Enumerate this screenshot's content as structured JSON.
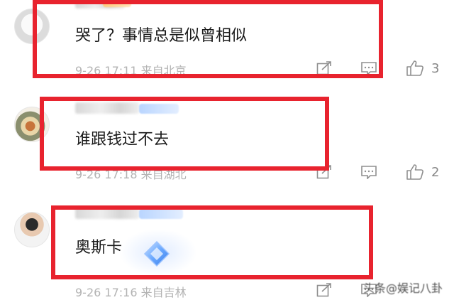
{
  "comments": [
    {
      "text": "哭了？事情总是似曾相似",
      "meta": "9-26 17:11 来自北京",
      "likes": "3",
      "avatar_icon": "dog-avatar"
    },
    {
      "text": "谁跟钱过不去",
      "meta": "9-26 17:18 来自湖北",
      "likes": "2",
      "avatar_icon": "food-avatar"
    },
    {
      "text": "奥斯卡",
      "meta": "9-26 17:16 来自吉林",
      "likes": "",
      "avatar_icon": "person-avatar"
    }
  ],
  "icons": {
    "share": "share-icon",
    "reply": "reply-icon",
    "like": "thumbs-up-icon",
    "sticker": "diamond-sticker-icon"
  },
  "highlight_color": "#e8232e",
  "watermark": "头条@娱记八卦"
}
